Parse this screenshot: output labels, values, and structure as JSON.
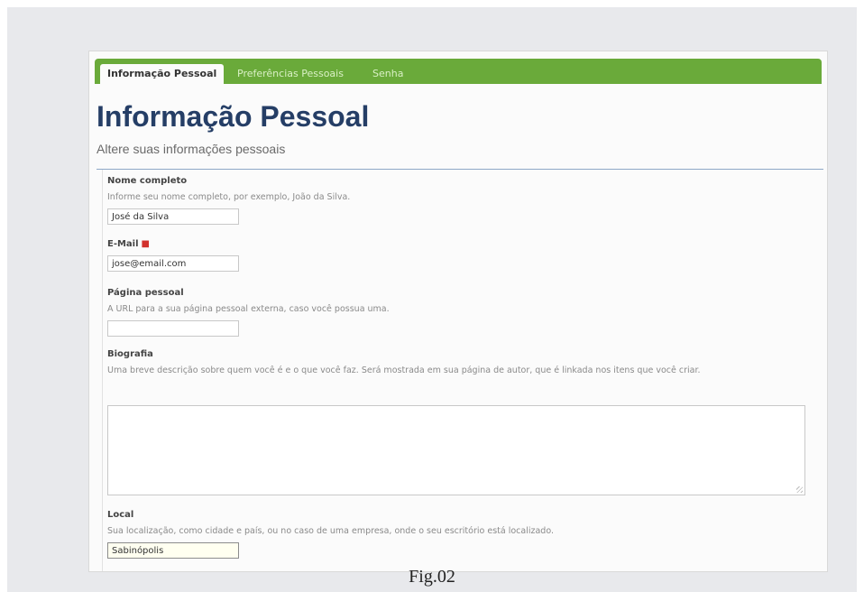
{
  "tabs": [
    {
      "label": "Informação Pessoal",
      "active": true
    },
    {
      "label": "Preferências Pessoais",
      "active": false
    },
    {
      "label": "Senha",
      "active": false
    }
  ],
  "header": {
    "title": "Informação Pessoal",
    "subtitle": "Altere suas informações pessoais"
  },
  "fields": {
    "fullname": {
      "label": "Nome completo",
      "help": "Informe seu nome completo, por exemplo, João da Silva.",
      "value": "José da Silva"
    },
    "email": {
      "label": "E-Mail",
      "required_marker": "■",
      "value": "jose@email.com"
    },
    "homepage": {
      "label": "Página pessoal",
      "help": "A URL para a sua página pessoal externa, caso você possua uma.",
      "value": ""
    },
    "bio": {
      "label": "Biografia",
      "help": "Uma breve descrição sobre quem você é e o que você faz. Será mostrada em sua página de autor, que é linkada nos itens que você criar.",
      "value": ""
    },
    "location": {
      "label": "Local",
      "help": "Sua localização, como cidade e país, ou no caso de uma empresa, onde o seu escritório está localizado.",
      "value": "Sabinópolis"
    }
  },
  "caption": "Fig.02",
  "colors": {
    "tabbar": "#6aaa3a",
    "title": "#253e66",
    "required": "#d2322d"
  }
}
